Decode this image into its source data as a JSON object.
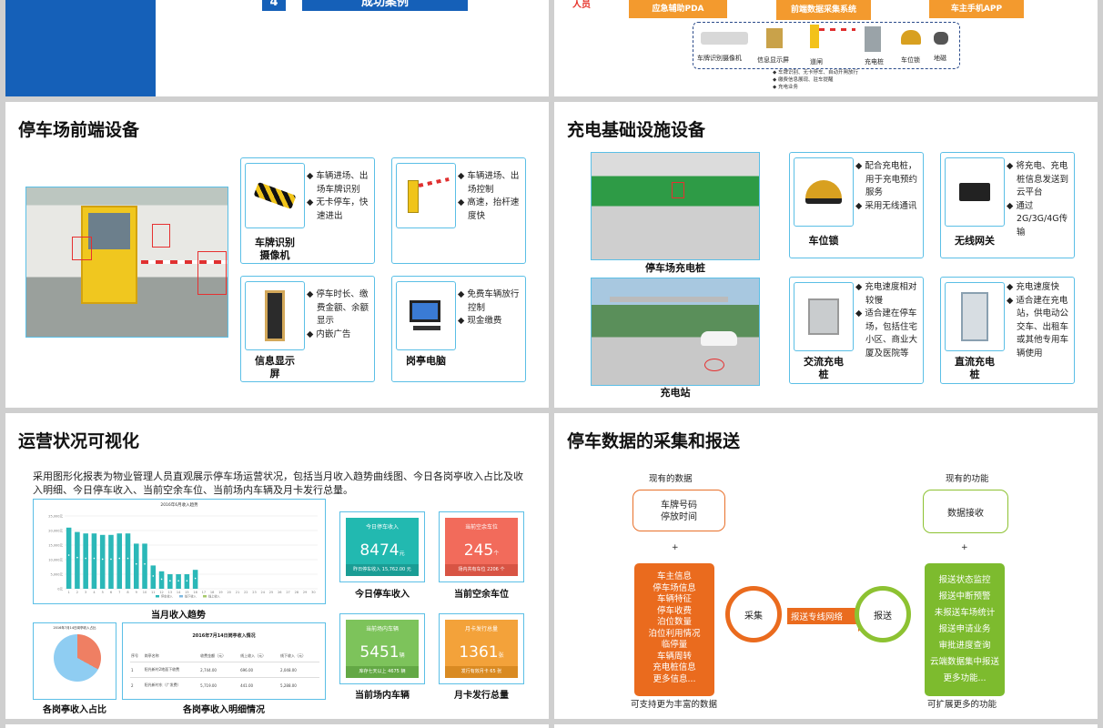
{
  "top_left": {
    "num": "4",
    "title": "成功案例"
  },
  "top_right": {
    "left_label": "人员",
    "buttons": [
      "应急辅助PDA",
      "前端数据采集系统",
      "车主手机APP"
    ],
    "devices": [
      "车牌识别摄像机",
      "信息显示屏",
      "道闸",
      "充电桩",
      "车位锁",
      "地磁"
    ],
    "notes": [
      "车牌识别、无卡停车、自动开闸放行",
      "缴费信息展现、驻车提醒",
      "充电业务"
    ]
  },
  "slide_front": {
    "title": "停车场前端设备",
    "cards": [
      {
        "label": "车牌识别\n摄像机",
        "bullets": [
          "◆ 车辆进场、出场车牌识别",
          "◆ 无卡停车，快速进出"
        ]
      },
      {
        "label": "道闸",
        "bullets": [
          "◆ 车辆进场、出场控制",
          "◆ 高速，抬杆速度快"
        ]
      },
      {
        "label": "信息显示\n屏",
        "bullets": [
          "◆ 停车时长、缴费金额、余额显示",
          "◆ 内嵌广告"
        ]
      },
      {
        "label": "岗亭电脑",
        "bullets": [
          "◆ 免费车辆放行控制",
          "◆ 现金缴费"
        ]
      }
    ]
  },
  "slide_charge": {
    "title": "充电基础设施设备",
    "photo1_label": "停车场充电桩",
    "photo2_label": "充电站",
    "cards": [
      {
        "label": "车位锁",
        "bullets": [
          "◆ 配合充电桩，用于充电预约服务",
          "◆ 采用无线通讯"
        ]
      },
      {
        "label": "无线网关",
        "bullets": [
          "◆ 将充电、充电桩信息发送到云平台",
          "◆ 通过2G/3G/4G传输"
        ]
      },
      {
        "label": "交流充电\n桩",
        "bullets": [
          "◆ 充电速度相对较慢",
          "◆ 适合建在停车场，包括住宅小区、商业大厦及医院等"
        ]
      },
      {
        "label": "直流充电\n桩",
        "bullets": [
          "◆ 充电速度快",
          "◆ 适合建在充电站，供电动公交车、出租车或其他专用车辆使用"
        ]
      }
    ]
  },
  "slide_ops": {
    "title": "运营状况可视化",
    "desc": "采用图形化报表为物业管理人员直观展示停车场运营状况，包括当月收入趋势曲线图、今日各岗亭收入占比及收入明细、今日停车收入、当前空余车位、当前场内车辆及月卡发行总量。",
    "chart_title": "2016年6月收入趋势",
    "chart_caption": "当月收入趋势",
    "pie_title": "2016年7月14日岗亭收入占比",
    "pie_caption": "各岗亭收入占比",
    "table_title": "2016年7月14日岗亭收入情况",
    "table_caption": "各岗亭收入明细情况",
    "table_headers": [
      "序号",
      "岗亭名称",
      "收费金额（元）",
      "线上收入（元）",
      "线下收入（元）"
    ],
    "table_rows": [
      [
        "1",
        "阳光新村2地面下收费",
        "2,744.00",
        "696.00",
        "2,048.00"
      ],
      [
        "2",
        "阳光新村东（广发费）",
        "5,719.00",
        "441.00",
        "5,288.00"
      ]
    ],
    "kpis": [
      {
        "title": "今日停车收入",
        "value": "8474",
        "unit": "元",
        "foot": "昨日停车收入 15,762.00 元",
        "caption": "今日停车收入",
        "color": "#22b9b0"
      },
      {
        "title": "当前空余车位",
        "value": "245",
        "unit": "个",
        "foot": "场内共有车位 2206 个",
        "caption": "当前空余车位",
        "color": "#f26b5b"
      },
      {
        "title": "当前场内车辆",
        "value": "5451",
        "unit": "辆",
        "foot": "库存七天以上 4675 辆",
        "caption": "当前场内车辆",
        "color": "#7dc35b"
      },
      {
        "title": "月卡发行总量",
        "value": "1361",
        "unit": "张",
        "foot": "发行有效月卡 65 张",
        "caption": "月卡发行总量",
        "color": "#f3a23a"
      }
    ],
    "legend": [
      "停车收入",
      "线下收入",
      "线上收入"
    ]
  },
  "chart_data": {
    "type": "bar",
    "title": "2016年6月收入趋势",
    "categories": [
      "1",
      "2",
      "3",
      "4",
      "5",
      "6",
      "7",
      "8",
      "9",
      "10",
      "11",
      "12",
      "13",
      "14",
      "15",
      "16",
      "17",
      "18",
      "19",
      "20",
      "21",
      "22",
      "23",
      "24",
      "25",
      "26",
      "27",
      "28",
      "29",
      "30"
    ],
    "values": [
      21000,
      19500,
      19000,
      19000,
      18500,
      18500,
      19000,
      19000,
      15500,
      15500,
      8000,
      6000,
      5000,
      5000,
      5000,
      6500,
      0,
      0,
      0,
      0,
      0,
      0,
      0,
      0,
      0,
      0,
      0,
      0,
      0,
      0
    ],
    "yticks": [
      "25,000元",
      "20,000元",
      "15,000元",
      "10,000元",
      "5,000元",
      "0元"
    ],
    "ylim": [
      0,
      25000
    ]
  },
  "slide_data": {
    "title": "停车数据的采集和报送",
    "left_head": "现有的数据",
    "right_head": "现有的功能",
    "left_top": [
      "车牌号码",
      "停放时间"
    ],
    "right_top": [
      "数据接收"
    ],
    "plus": "+",
    "left_list": [
      "车主信息",
      "停车场信息",
      "车辆特征",
      "停车收费",
      "泊位数量",
      "泊位利用情况",
      "临停量",
      "车辆周转",
      "充电桩信息",
      "更多信息..."
    ],
    "right_list": [
      "报送状态监控",
      "报送中断预警",
      "未报送车场统计",
      "报送申请业务",
      "审批进度查询",
      "云端数据集中报送",
      "更多功能..."
    ],
    "collect": "采集",
    "report": "报送",
    "arrow_label": "报送专线网络",
    "left_foot": "可支持更为丰富的数据",
    "right_foot": "可扩展更多的功能"
  }
}
